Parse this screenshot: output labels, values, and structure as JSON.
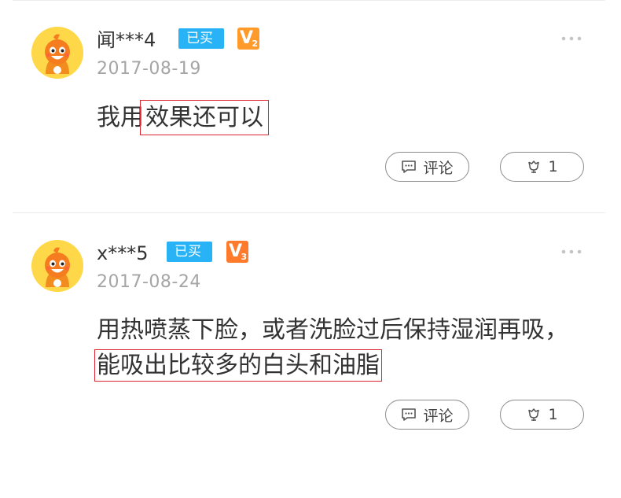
{
  "reviews": [
    {
      "username": "闻***4",
      "bought_badge": "已买",
      "level": "2",
      "date": "2017-08-19",
      "content_plain": "我用",
      "content_highlight": "效果还可以",
      "comment_label": "评论",
      "likes": "1"
    },
    {
      "username": "x***5",
      "bought_badge": "已买",
      "level": "3",
      "date": "2017-08-24",
      "content_plain": "用热喷蒸下脸，或者洗脸过后保持湿润再吸，",
      "content_highlight": "能吸出比较多的白头和油脂",
      "comment_label": "评论",
      "likes": "1"
    }
  ],
  "colors": {
    "badge_blue": "#27b3f5",
    "level_orange": "#ff9a2b",
    "highlight_red": "#d9252b",
    "avatar_yellow": "#ffd84a"
  }
}
